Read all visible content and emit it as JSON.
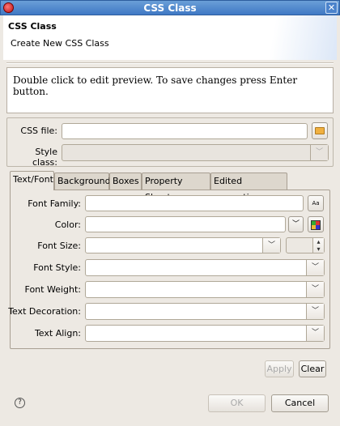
{
  "window": {
    "title": "CSS Class",
    "close": "✕"
  },
  "header": {
    "title": "CSS Class",
    "subtitle": "Create New CSS Class"
  },
  "preview": {
    "text": "Double click to edit preview. To save changes press Enter button."
  },
  "source": {
    "css_file_label": "CSS file:",
    "css_file_value": "",
    "style_class_label": "Style class:",
    "style_class_value": ""
  },
  "tabs": [
    {
      "label": "Text/Font",
      "active": true
    },
    {
      "label": "Background"
    },
    {
      "label": "Boxes"
    },
    {
      "label": "Property Sheet"
    },
    {
      "label": "Edited properties"
    }
  ],
  "fields": {
    "font_family": "Font Family:",
    "color": "Color:",
    "font_size": "Font Size:",
    "font_style": "Font Style:",
    "font_weight": "Font Weight:",
    "text_decoration": "Text Decoration:",
    "text_align": "Text Align:"
  },
  "buttons": {
    "apply": "Apply",
    "clear": "Clear",
    "ok": "OK",
    "cancel": "Cancel",
    "help": "?"
  }
}
